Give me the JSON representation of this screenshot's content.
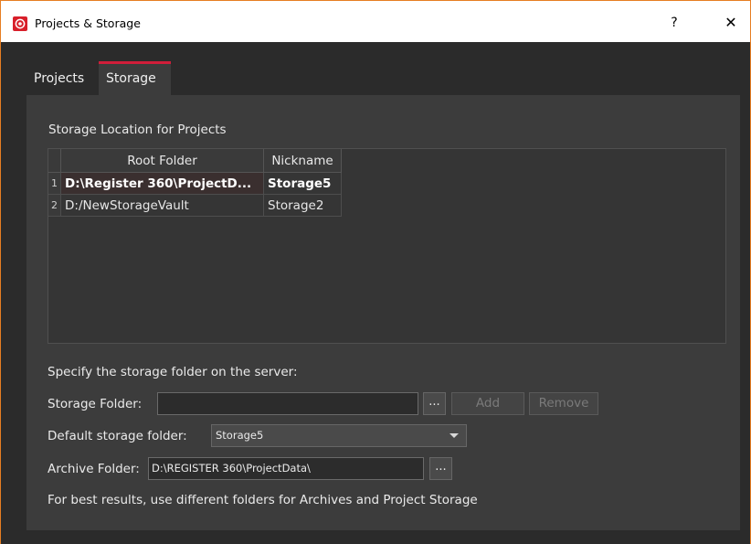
{
  "window": {
    "title": "Projects & Storage",
    "help_label": "?",
    "close_label": "✕"
  },
  "tabs": [
    {
      "label": "Projects",
      "selected": false
    },
    {
      "label": "Storage",
      "selected": true
    }
  ],
  "storage": {
    "section_title": "Storage Location for Projects",
    "table": {
      "columns": [
        "Root Folder",
        "Nickname"
      ],
      "rows": [
        {
          "num": "1",
          "root_folder": "D:\\Register 360\\ProjectD...",
          "nickname": "Storage5",
          "selected": true
        },
        {
          "num": "2",
          "root_folder": "D:/NewStorageVault",
          "nickname": "Storage2",
          "selected": false
        }
      ]
    },
    "server_instruction": "Specify the storage folder on the server:",
    "storage_folder_label": "Storage Folder:",
    "storage_folder_value": "",
    "browse_label": "...",
    "add_label": "Add",
    "remove_label": "Remove",
    "default_folder_label": "Default storage folder:",
    "default_folder_value": "Storage5",
    "archive_folder_label": "Archive Folder:",
    "archive_folder_value": "D:\\REGISTER 360\\ProjectData\\",
    "archive_browse_label": "...",
    "hint": "For best results, use different folders for Archives and Project Storage"
  },
  "colors": {
    "accent": "#d01e3a",
    "window_border": "#e67e22",
    "background": "#2b2b2b",
    "panel": "#3c3c3c"
  }
}
